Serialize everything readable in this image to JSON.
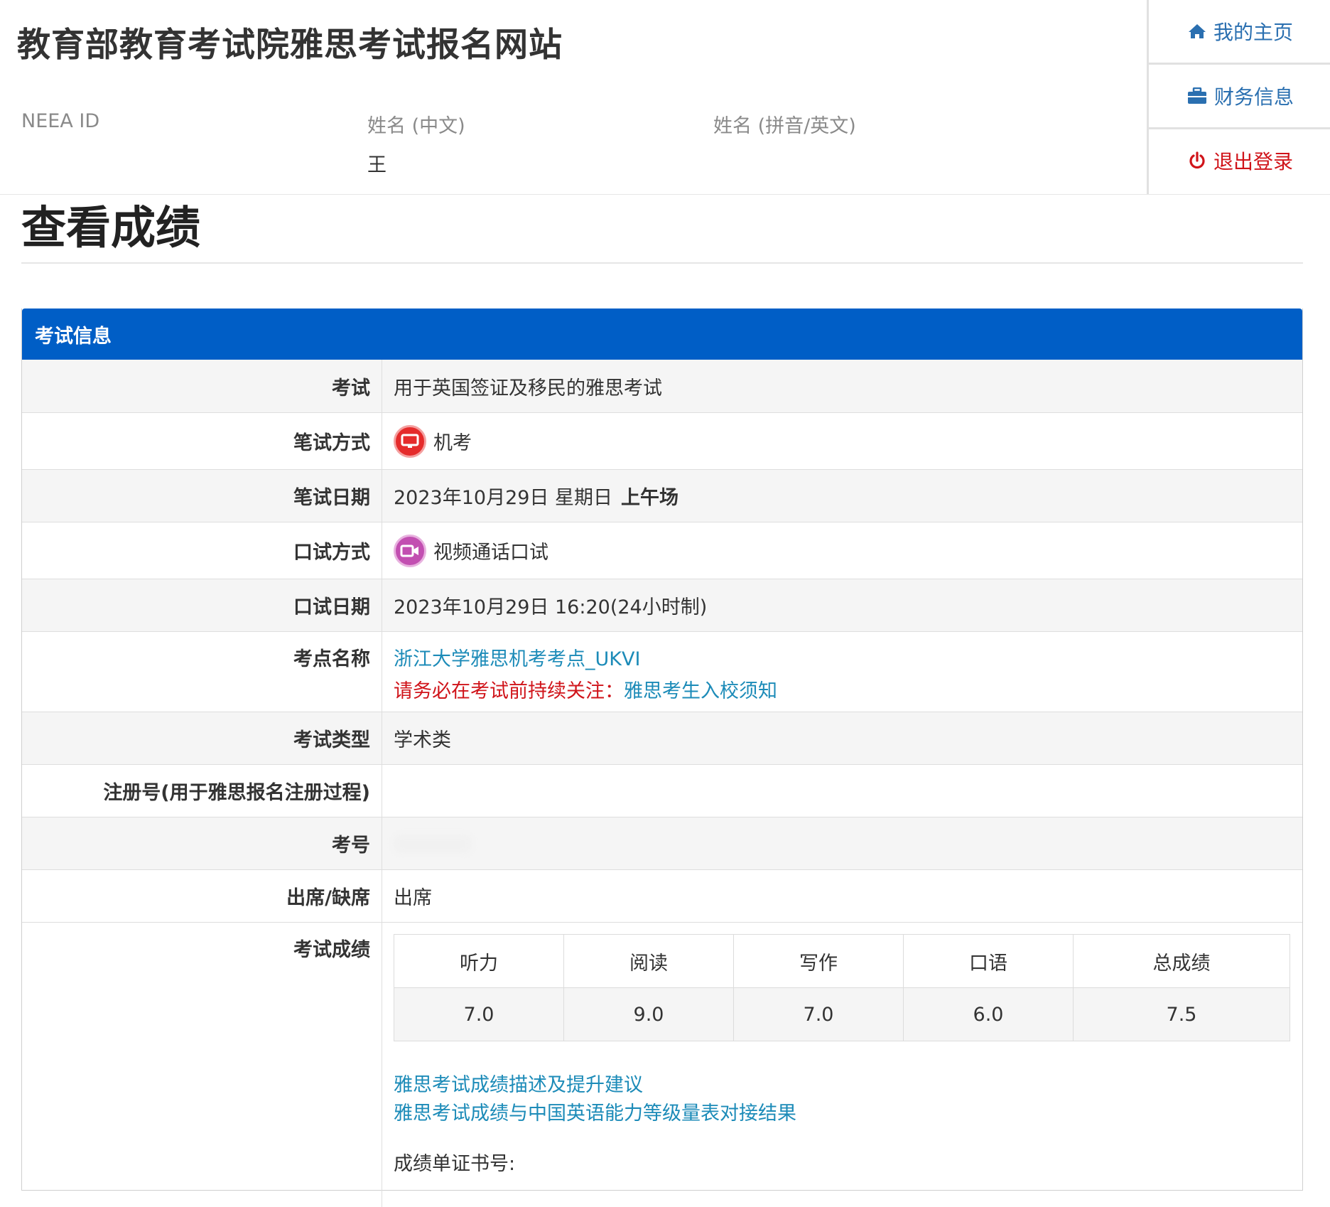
{
  "header": {
    "site_title": "教育部教育考试院雅思考试报名网站",
    "neea_label": "NEEA ID",
    "name_cn_label": "姓名 (中文)",
    "name_cn_value": "王",
    "name_en_label": "姓名 (拼音/英文)"
  },
  "side_menu": {
    "home": "我的主页",
    "finance": "财务信息",
    "logout": "退出登录"
  },
  "page_title": "查看成绩",
  "panel": {
    "title": "考试信息",
    "rows": {
      "exam_label": "考试",
      "exam_value": "用于英国签证及移民的雅思考试",
      "written_mode_label": "笔试方式",
      "written_mode_value": "机考",
      "written_date_label": "笔试日期",
      "written_date_value": "2023年10月29日 星期日",
      "written_session": "上午场",
      "speaking_mode_label": "口试方式",
      "speaking_mode_value": "视频通话口试",
      "speaking_date_label": "口试日期",
      "speaking_date_value": "2023年10月29日 16:20(24小时制)",
      "venue_label": "考点名称",
      "venue_link": "浙江大学雅思机考考点_UKVI",
      "venue_notice": "请务必在考试前持续关注：",
      "venue_notice_link": "雅思考生入校须知",
      "exam_type_label": "考试类型",
      "exam_type_value": "学术类",
      "registration_label": "注册号(用于雅思报名注册过程)",
      "exam_no_label": "考号",
      "attendance_label": "出席/缺席",
      "attendance_value": "出席",
      "score_label": "考试成绩"
    },
    "scores": {
      "headers": [
        "听力",
        "阅读",
        "写作",
        "口语",
        "总成绩"
      ],
      "values": [
        "7.0",
        "9.0",
        "7.0",
        "6.0",
        "7.5"
      ]
    },
    "score_links": {
      "description": "雅思考试成绩描述及提升建议",
      "cse": "雅思考试成绩与中国英语能力等级量表对接结果"
    },
    "certificate_label": "成绩单证书号:"
  },
  "colors": {
    "panel_header": "#005ec6",
    "link": "#1c8bb8",
    "warning": "#d0141a"
  }
}
